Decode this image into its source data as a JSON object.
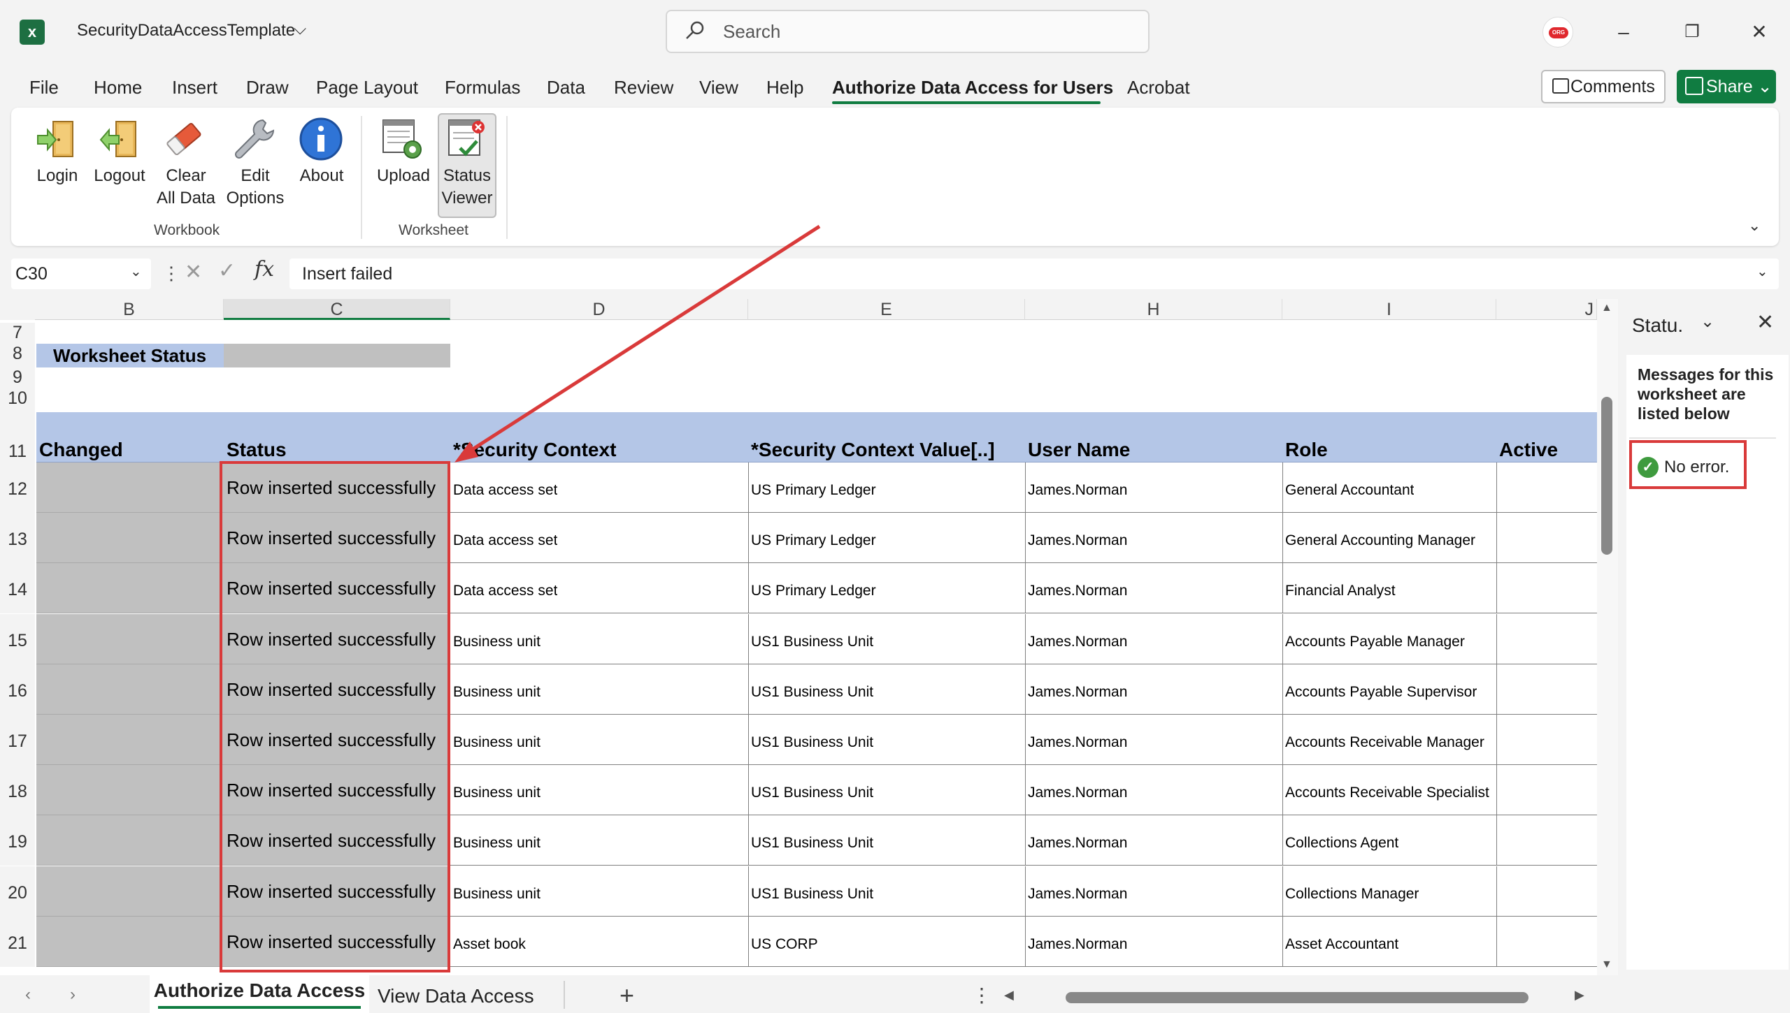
{
  "app": {
    "title": "SecurityDataAccessTemplate",
    "search_placeholder": "Search",
    "user_badge": "ORG"
  },
  "menu": {
    "tabs": [
      "File",
      "Home",
      "Insert",
      "Draw",
      "Page Layout",
      "Formulas",
      "Data",
      "Review",
      "View",
      "Help",
      "Authorize Data Access for Users",
      "Acrobat"
    ],
    "active": "Authorize Data Access for Users",
    "comments": "Comments",
    "share": "Share"
  },
  "ribbon": {
    "workbook_buttons": [
      {
        "label": "Login",
        "icon": "login-door-icon"
      },
      {
        "label": "Logout",
        "icon": "logout-door-icon"
      },
      {
        "label": "Clear\nAll Data",
        "icon": "eraser-icon"
      },
      {
        "label": "Edit\nOptions",
        "icon": "wrench-icon"
      },
      {
        "label": "About",
        "icon": "info-icon"
      }
    ],
    "worksheet_buttons": [
      {
        "label": "Upload",
        "icon": "upload-sheet-icon"
      },
      {
        "label": "Status\nViewer",
        "icon": "status-viewer-icon"
      }
    ],
    "group_workbook": "Workbook",
    "group_worksheet": "Worksheet"
  },
  "formula_bar": {
    "name_box": "C30",
    "formula": "Insert failed",
    "fx": "fx"
  },
  "grid": {
    "columns": [
      "B",
      "C",
      "D",
      "E",
      "H",
      "I",
      "J"
    ],
    "selected_column": "C",
    "row_numbers_top": [
      "7",
      "8",
      "9",
      "10"
    ],
    "worksheet_status_label": "Worksheet Status",
    "header_row_number": "11",
    "headers": [
      "Changed",
      "Status",
      "*Security Context",
      "*Security Context Value[..]",
      "User Name",
      "Role",
      "Active"
    ],
    "rows": [
      {
        "num": "12",
        "status": "Row inserted successfully",
        "context": "Data access set",
        "value": "US Primary Ledger",
        "user": "James.Norman",
        "role": "General Accountant"
      },
      {
        "num": "13",
        "status": "Row inserted successfully",
        "context": "Data access set",
        "value": "US Primary Ledger",
        "user": "James.Norman",
        "role": "General Accounting Manager"
      },
      {
        "num": "14",
        "status": "Row inserted successfully",
        "context": "Data access set",
        "value": "US Primary Ledger",
        "user": "James.Norman",
        "role": "Financial Analyst"
      },
      {
        "num": "15",
        "status": "Row inserted successfully",
        "context": "Business unit",
        "value": "US1 Business Unit",
        "user": "James.Norman",
        "role": "Accounts Payable Manager"
      },
      {
        "num": "16",
        "status": "Row inserted successfully",
        "context": "Business unit",
        "value": "US1 Business Unit",
        "user": "James.Norman",
        "role": "Accounts Payable Supervisor"
      },
      {
        "num": "17",
        "status": "Row inserted successfully",
        "context": "Business unit",
        "value": "US1 Business Unit",
        "user": "James.Norman",
        "role": "Accounts Receivable Manager"
      },
      {
        "num": "18",
        "status": "Row inserted successfully",
        "context": "Business unit",
        "value": "US1 Business Unit",
        "user": "James.Norman",
        "role": "Accounts Receivable Specialist"
      },
      {
        "num": "19",
        "status": "Row inserted successfully",
        "context": "Business unit",
        "value": "US1 Business Unit",
        "user": "James.Norman",
        "role": "Collections Agent"
      },
      {
        "num": "20",
        "status": "Row inserted successfully",
        "context": "Business unit",
        "value": "US1 Business Unit",
        "user": "James.Norman",
        "role": "Collections Manager"
      },
      {
        "num": "21",
        "status": "Row inserted successfully",
        "context": "Asset book",
        "value": "US CORP",
        "user": "James.Norman",
        "role": "Asset Accountant"
      }
    ]
  },
  "task_pane": {
    "title": "Statu.",
    "message": "Messages for this worksheet are listed below",
    "status": "No error."
  },
  "sheets": {
    "tabs": [
      "Authorize Data Access",
      "View Data Access"
    ],
    "active": "Authorize Data Access"
  },
  "colors": {
    "accent": "#107c41",
    "header_fill": "#b4c6e7",
    "gray_fill": "#c0c0c0",
    "highlight": "#d93a3a"
  }
}
